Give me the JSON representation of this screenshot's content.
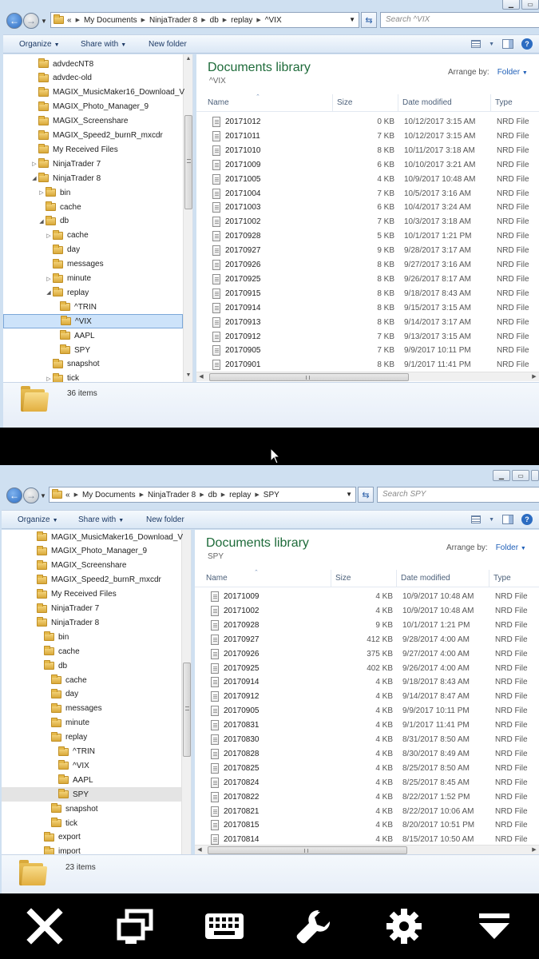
{
  "top_window": {
    "breadcrumb_prefix": "«",
    "breadcrumb": [
      "My Documents",
      "NinjaTrader 8",
      "db",
      "replay",
      "^VIX"
    ],
    "search_placeholder": "Search ^VIX",
    "toolbar": {
      "organize": "Organize",
      "share_with": "Share with",
      "new_folder": "New folder"
    },
    "library_title": "Documents library",
    "library_subtitle": "^VIX",
    "arrange_by_label": "Arrange by:",
    "arrange_by_value": "Folder",
    "columns": {
      "name": "Name",
      "size": "Size",
      "date": "Date modified",
      "type": "Type"
    },
    "tree": [
      {
        "label": "advdecNT8",
        "indent": 0,
        "arrow": ""
      },
      {
        "label": "advdec-old",
        "indent": 0,
        "arrow": ""
      },
      {
        "label": "MAGIX_MusicMaker16_Download_V",
        "indent": 0,
        "arrow": ""
      },
      {
        "label": "MAGIX_Photo_Manager_9",
        "indent": 0,
        "arrow": ""
      },
      {
        "label": "MAGIX_Screenshare",
        "indent": 0,
        "arrow": ""
      },
      {
        "label": "MAGIX_Speed2_burnR_mxcdr",
        "indent": 0,
        "arrow": ""
      },
      {
        "label": "My Received Files",
        "indent": 0,
        "arrow": ""
      },
      {
        "label": "NinjaTrader 7",
        "indent": 0,
        "arrow": "▷"
      },
      {
        "label": "NinjaTrader 8",
        "indent": 0,
        "arrow": "◢"
      },
      {
        "label": "bin",
        "indent": 1,
        "arrow": "▷"
      },
      {
        "label": "cache",
        "indent": 1,
        "arrow": ""
      },
      {
        "label": "db",
        "indent": 1,
        "arrow": "◢"
      },
      {
        "label": "cache",
        "indent": 2,
        "arrow": "▷"
      },
      {
        "label": "day",
        "indent": 2,
        "arrow": ""
      },
      {
        "label": "messages",
        "indent": 2,
        "arrow": ""
      },
      {
        "label": "minute",
        "indent": 2,
        "arrow": "▷"
      },
      {
        "label": "replay",
        "indent": 2,
        "arrow": "◢"
      },
      {
        "label": "^TRIN",
        "indent": 3,
        "arrow": ""
      },
      {
        "label": "^VIX",
        "indent": 3,
        "arrow": "",
        "selected": true
      },
      {
        "label": "AAPL",
        "indent": 3,
        "arrow": ""
      },
      {
        "label": "SPY",
        "indent": 3,
        "arrow": ""
      },
      {
        "label": "snapshot",
        "indent": 2,
        "arrow": ""
      },
      {
        "label": "tick",
        "indent": 2,
        "arrow": "▷"
      }
    ],
    "files": [
      {
        "name": "20171012",
        "size": "0 KB",
        "date": "10/12/2017 3:15 AM",
        "type": "NRD File"
      },
      {
        "name": "20171011",
        "size": "7 KB",
        "date": "10/12/2017 3:15 AM",
        "type": "NRD File"
      },
      {
        "name": "20171010",
        "size": "8 KB",
        "date": "10/11/2017 3:18 AM",
        "type": "NRD File"
      },
      {
        "name": "20171009",
        "size": "6 KB",
        "date": "10/10/2017 3:21 AM",
        "type": "NRD File"
      },
      {
        "name": "20171005",
        "size": "4 KB",
        "date": "10/9/2017 10:48 AM",
        "type": "NRD File"
      },
      {
        "name": "20171004",
        "size": "7 KB",
        "date": "10/5/2017 3:16 AM",
        "type": "NRD File"
      },
      {
        "name": "20171003",
        "size": "6 KB",
        "date": "10/4/2017 3:24 AM",
        "type": "NRD File"
      },
      {
        "name": "20171002",
        "size": "7 KB",
        "date": "10/3/2017 3:18 AM",
        "type": "NRD File"
      },
      {
        "name": "20170928",
        "size": "5 KB",
        "date": "10/1/2017 1:21 PM",
        "type": "NRD File"
      },
      {
        "name": "20170927",
        "size": "9 KB",
        "date": "9/28/2017 3:17 AM",
        "type": "NRD File"
      },
      {
        "name": "20170926",
        "size": "8 KB",
        "date": "9/27/2017 3:16 AM",
        "type": "NRD File"
      },
      {
        "name": "20170925",
        "size": "8 KB",
        "date": "9/26/2017 8:17 AM",
        "type": "NRD File"
      },
      {
        "name": "20170915",
        "size": "8 KB",
        "date": "9/18/2017 8:43 AM",
        "type": "NRD File"
      },
      {
        "name": "20170914",
        "size": "8 KB",
        "date": "9/15/2017 3:15 AM",
        "type": "NRD File"
      },
      {
        "name": "20170913",
        "size": "8 KB",
        "date": "9/14/2017 3:17 AM",
        "type": "NRD File"
      },
      {
        "name": "20170912",
        "size": "7 KB",
        "date": "9/13/2017 3:15 AM",
        "type": "NRD File"
      },
      {
        "name": "20170905",
        "size": "7 KB",
        "date": "9/9/2017 10:11 PM",
        "type": "NRD File"
      },
      {
        "name": "20170901",
        "size": "8 KB",
        "date": "9/1/2017 11:41 PM",
        "type": "NRD File"
      }
    ],
    "item_count": "36 items"
  },
  "bottom_window": {
    "breadcrumb_prefix": "«",
    "breadcrumb": [
      "My Documents",
      "NinjaTrader 8",
      "db",
      "replay",
      "SPY"
    ],
    "search_placeholder": "Search SPY",
    "toolbar": {
      "organize": "Organize",
      "share_with": "Share with",
      "new_folder": "New folder"
    },
    "library_title": "Documents library",
    "library_subtitle": "SPY",
    "arrange_by_label": "Arrange by:",
    "arrange_by_value": "Folder",
    "columns": {
      "name": "Name",
      "size": "Size",
      "date": "Date modified",
      "type": "Type"
    },
    "tree": [
      {
        "label": "MAGIX_MusicMaker16_Download_V",
        "indent": 0,
        "arrow": ""
      },
      {
        "label": "MAGIX_Photo_Manager_9",
        "indent": 0,
        "arrow": ""
      },
      {
        "label": "MAGIX_Screenshare",
        "indent": 0,
        "arrow": ""
      },
      {
        "label": "MAGIX_Speed2_burnR_mxcdr",
        "indent": 0,
        "arrow": ""
      },
      {
        "label": "My Received Files",
        "indent": 0,
        "arrow": ""
      },
      {
        "label": "NinjaTrader 7",
        "indent": 0,
        "arrow": ""
      },
      {
        "label": "NinjaTrader 8",
        "indent": 0,
        "arrow": ""
      },
      {
        "label": "bin",
        "indent": 1,
        "arrow": ""
      },
      {
        "label": "cache",
        "indent": 1,
        "arrow": ""
      },
      {
        "label": "db",
        "indent": 1,
        "arrow": ""
      },
      {
        "label": "cache",
        "indent": 2,
        "arrow": ""
      },
      {
        "label": "day",
        "indent": 2,
        "arrow": ""
      },
      {
        "label": "messages",
        "indent": 2,
        "arrow": ""
      },
      {
        "label": "minute",
        "indent": 2,
        "arrow": ""
      },
      {
        "label": "replay",
        "indent": 2,
        "arrow": ""
      },
      {
        "label": "^TRIN",
        "indent": 3,
        "arrow": ""
      },
      {
        "label": "^VIX",
        "indent": 3,
        "arrow": ""
      },
      {
        "label": "AAPL",
        "indent": 3,
        "arrow": ""
      },
      {
        "label": "SPY",
        "indent": 3,
        "arrow": "",
        "selected": true
      },
      {
        "label": "snapshot",
        "indent": 2,
        "arrow": ""
      },
      {
        "label": "tick",
        "indent": 2,
        "arrow": ""
      },
      {
        "label": "export",
        "indent": 1,
        "arrow": ""
      },
      {
        "label": "import",
        "indent": 1,
        "arrow": ""
      }
    ],
    "files": [
      {
        "name": "20171009",
        "size": "4 KB",
        "date": "10/9/2017 10:48 AM",
        "type": "NRD File"
      },
      {
        "name": "20171002",
        "size": "4 KB",
        "date": "10/9/2017 10:48 AM",
        "type": "NRD File"
      },
      {
        "name": "20170928",
        "size": "9 KB",
        "date": "10/1/2017 1:21 PM",
        "type": "NRD File"
      },
      {
        "name": "20170927",
        "size": "412 KB",
        "date": "9/28/2017 4:00 AM",
        "type": "NRD File"
      },
      {
        "name": "20170926",
        "size": "375 KB",
        "date": "9/27/2017 4:00 AM",
        "type": "NRD File"
      },
      {
        "name": "20170925",
        "size": "402 KB",
        "date": "9/26/2017 4:00 AM",
        "type": "NRD File"
      },
      {
        "name": "20170914",
        "size": "4 KB",
        "date": "9/18/2017 8:43 AM",
        "type": "NRD File"
      },
      {
        "name": "20170912",
        "size": "4 KB",
        "date": "9/14/2017 8:47 AM",
        "type": "NRD File"
      },
      {
        "name": "20170905",
        "size": "4 KB",
        "date": "9/9/2017 10:11 PM",
        "type": "NRD File"
      },
      {
        "name": "20170831",
        "size": "4 KB",
        "date": "9/1/2017 11:41 PM",
        "type": "NRD File"
      },
      {
        "name": "20170830",
        "size": "4 KB",
        "date": "8/31/2017 8:50 AM",
        "type": "NRD File"
      },
      {
        "name": "20170828",
        "size": "4 KB",
        "date": "8/30/2017 8:49 AM",
        "type": "NRD File"
      },
      {
        "name": "20170825",
        "size": "4 KB",
        "date": "8/25/2017 8:50 AM",
        "type": "NRD File"
      },
      {
        "name": "20170824",
        "size": "4 KB",
        "date": "8/25/2017 8:45 AM",
        "type": "NRD File"
      },
      {
        "name": "20170822",
        "size": "4 KB",
        "date": "8/22/2017 1:52 PM",
        "type": "NRD File"
      },
      {
        "name": "20170821",
        "size": "4 KB",
        "date": "8/22/2017 10:06 AM",
        "type": "NRD File"
      },
      {
        "name": "20170815",
        "size": "4 KB",
        "date": "8/20/2017 10:51 PM",
        "type": "NRD File"
      },
      {
        "name": "20170814",
        "size": "4 KB",
        "date": "8/15/2017 10:50 AM",
        "type": "NRD File"
      }
    ],
    "item_count": "23 items"
  },
  "remote_toolbar": {
    "buttons": [
      {
        "name": "close-icon"
      },
      {
        "name": "switch-monitor-icon"
      },
      {
        "name": "keyboard-icon"
      },
      {
        "name": "wrench-icon"
      },
      {
        "name": "gear-icon"
      },
      {
        "name": "hide-toolbar-icon"
      }
    ]
  },
  "colors": {
    "library_title": "#1e6b3a",
    "selection": "#cde3fa",
    "accent": "#2c6cc1"
  }
}
